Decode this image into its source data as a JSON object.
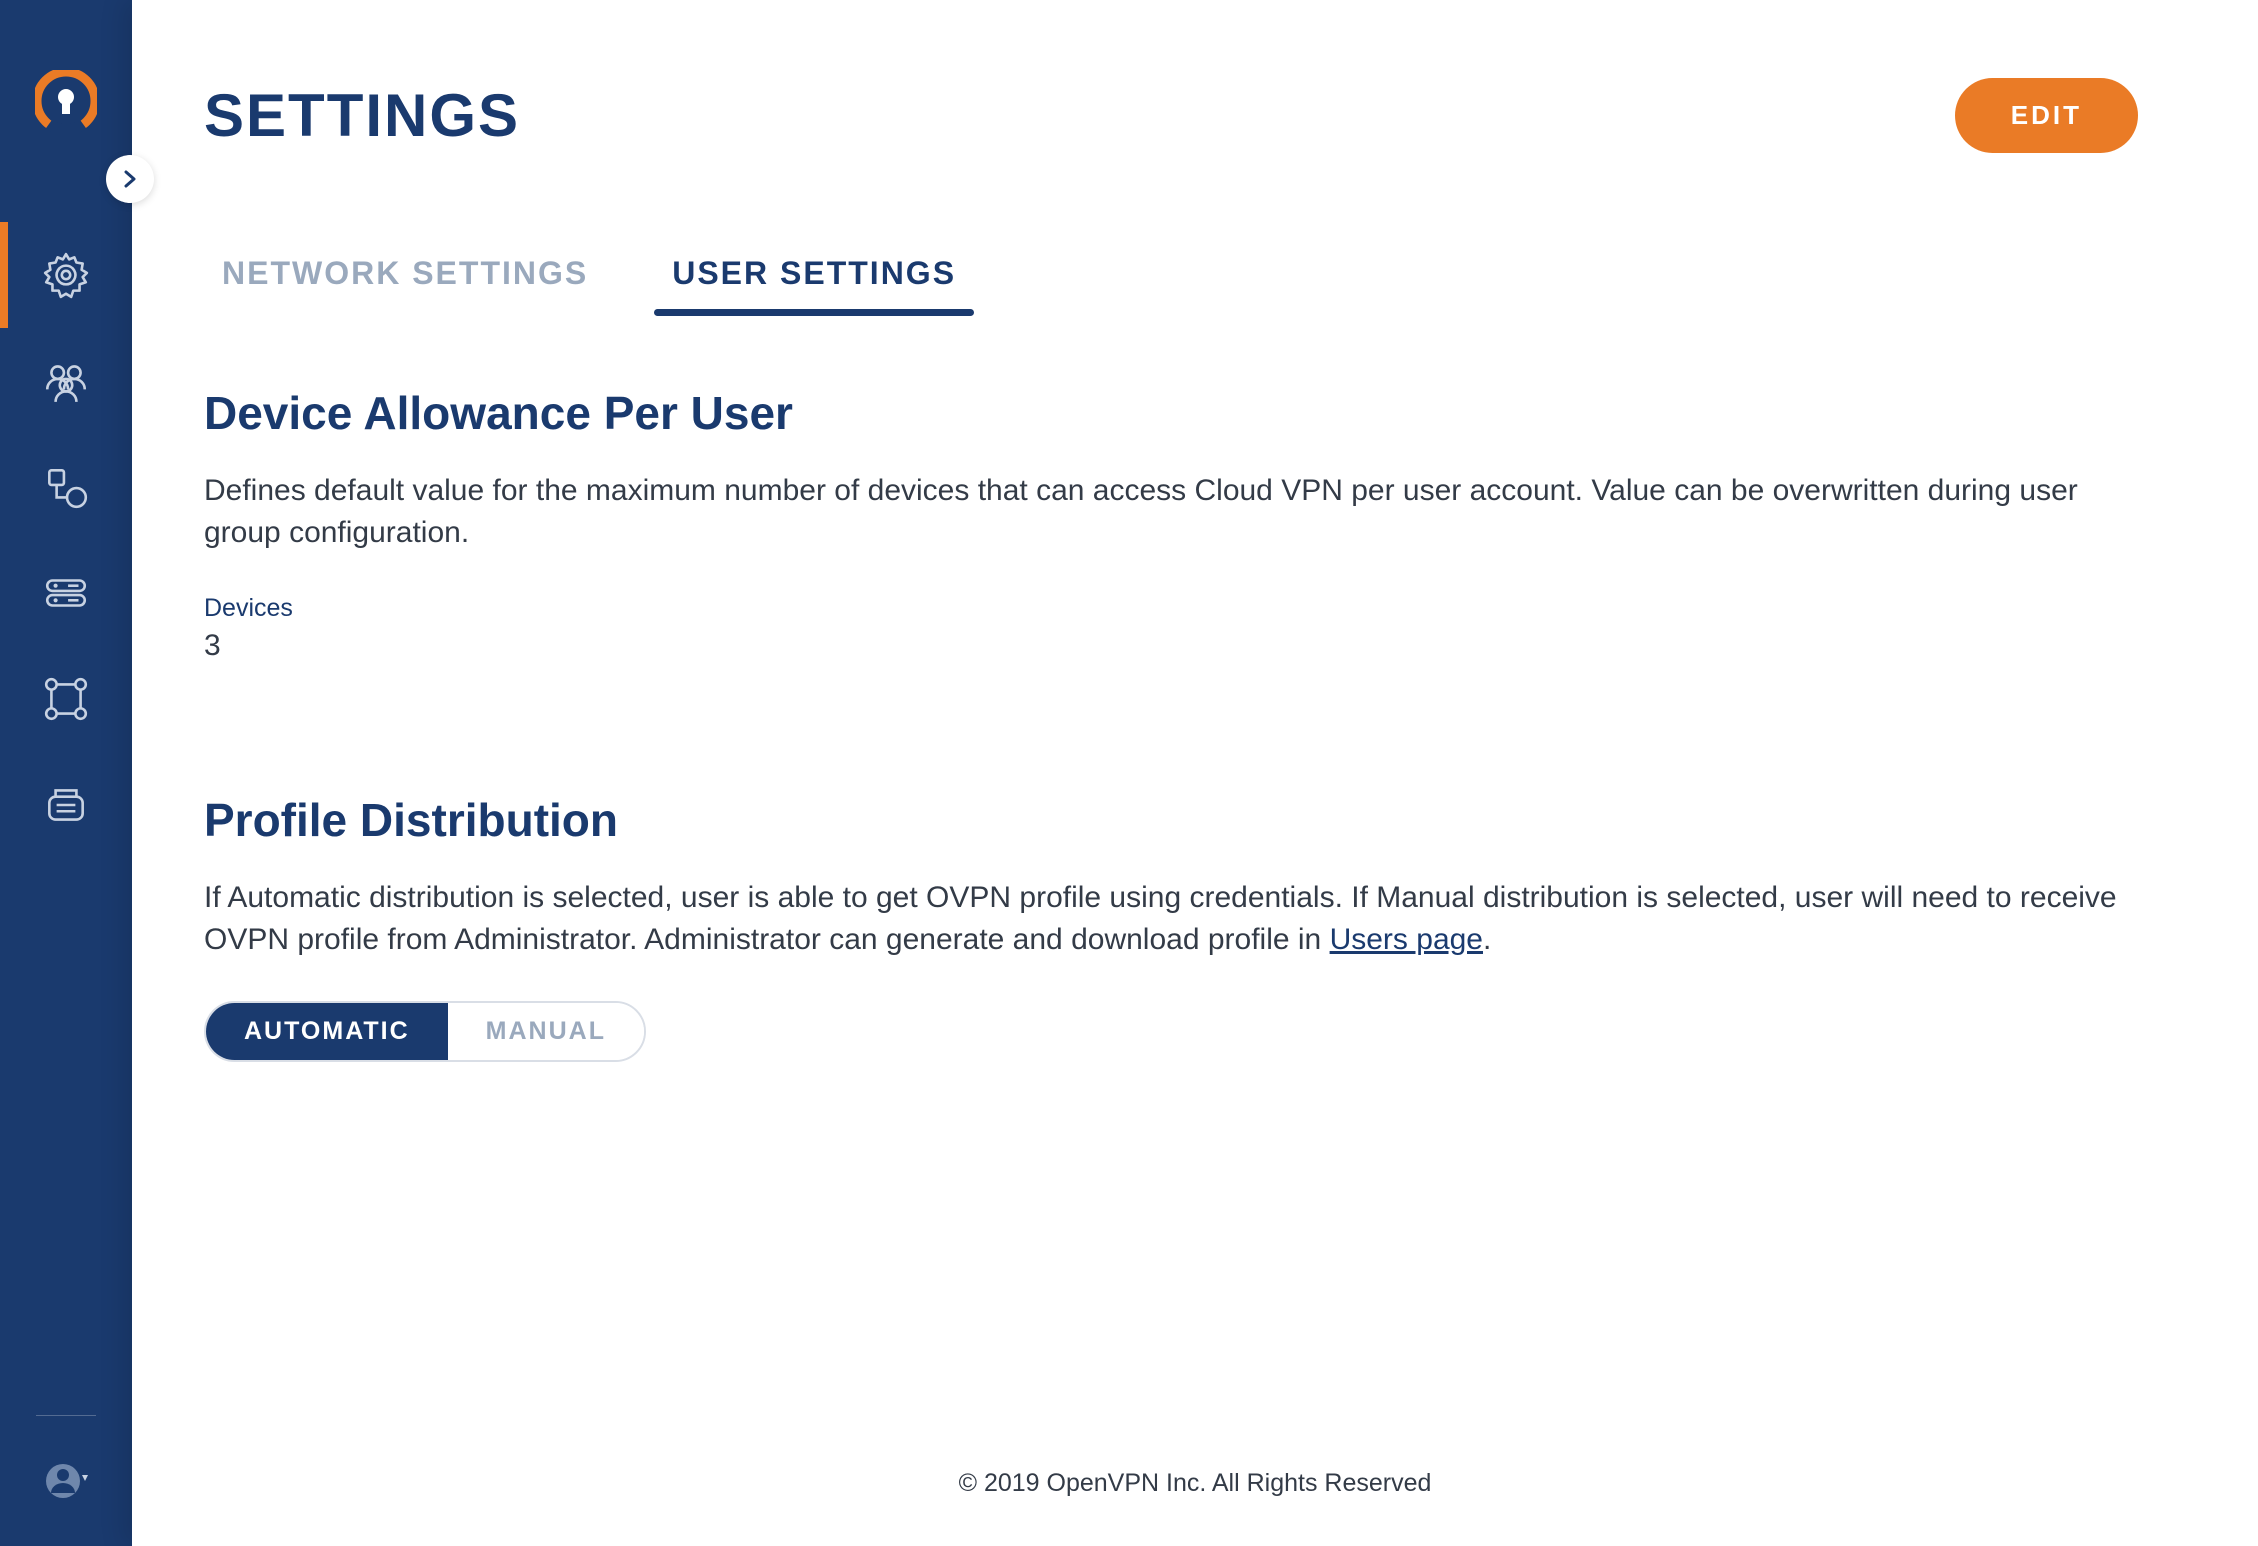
{
  "sidebar": {
    "items": [
      {
        "name": "settings",
        "active": true
      },
      {
        "name": "users",
        "active": false
      },
      {
        "name": "networks",
        "active": false
      },
      {
        "name": "hosts",
        "active": false
      },
      {
        "name": "topology",
        "active": false
      },
      {
        "name": "logs",
        "active": false
      }
    ]
  },
  "header": {
    "title": "SETTINGS",
    "edit_label": "EDIT"
  },
  "tabs": {
    "network": "NETWORK SETTINGS",
    "user": "USER SETTINGS"
  },
  "device_allowance": {
    "title": "Device Allowance Per User",
    "description": "Defines default value for the maximum number of devices that can access Cloud VPN per user account. Value can be overwritten during user group configuration.",
    "field_label": "Devices",
    "value": "3"
  },
  "profile_distribution": {
    "title": "Profile Distribution",
    "description_before_link": "If Automatic distribution is selected, user is able to get OVPN profile using credentials. If Manual distribution is selected, user will need to receive OVPN profile from Administrator. Administrator can generate and download profile in ",
    "link_text": "Users page",
    "description_after_link": ".",
    "option_automatic": "AUTOMATIC",
    "option_manual": "MANUAL",
    "selected": "automatic"
  },
  "footer": {
    "text": "© 2019 OpenVPN Inc. All Rights Reserved"
  }
}
